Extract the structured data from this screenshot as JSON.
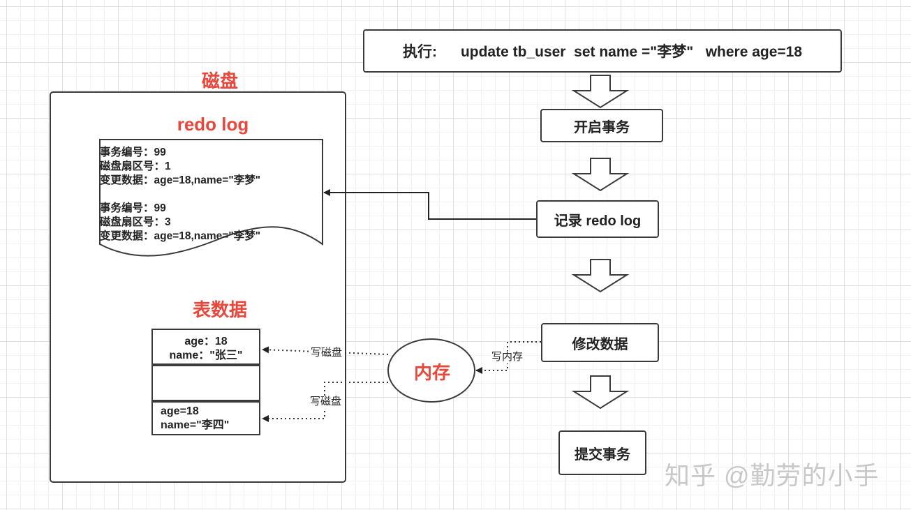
{
  "exec_box": {
    "label": "执行:",
    "sql": "update tb_user  set name =\"李梦\"   where age=18"
  },
  "flow_steps": {
    "begin": "开启事务",
    "record": "记录 redo log",
    "modify": "修改数据",
    "commit": "提交事务"
  },
  "disk": {
    "title": "磁盘",
    "redo_title": "redo log",
    "redo_entries": [
      {
        "tx": "事务编号：99",
        "sector": "磁盘扇区号：1",
        "change": "变更数据：age=18,name=\"李梦\""
      },
      {
        "tx": "事务编号：99",
        "sector": "磁盘扇区号：3",
        "change": "变更数据：age=18,name=\"李梦\""
      }
    ],
    "table_title": "表数据",
    "rows": [
      {
        "line1": "age：18",
        "line2": "name：\"张三\""
      },
      {
        "line1": "",
        "line2": ""
      },
      {
        "line1": "age=18",
        "line2": "name=\"李四\""
      }
    ]
  },
  "memory": {
    "label": "内存"
  },
  "edge_labels": {
    "write_disk_1": "写磁盘",
    "write_disk_2": "写磁盘",
    "write_memory": "写内存"
  },
  "watermark": "知乎 @勤劳的小手",
  "colors": {
    "accent_red": "#e8473c",
    "stroke": "#3a3a3a"
  }
}
